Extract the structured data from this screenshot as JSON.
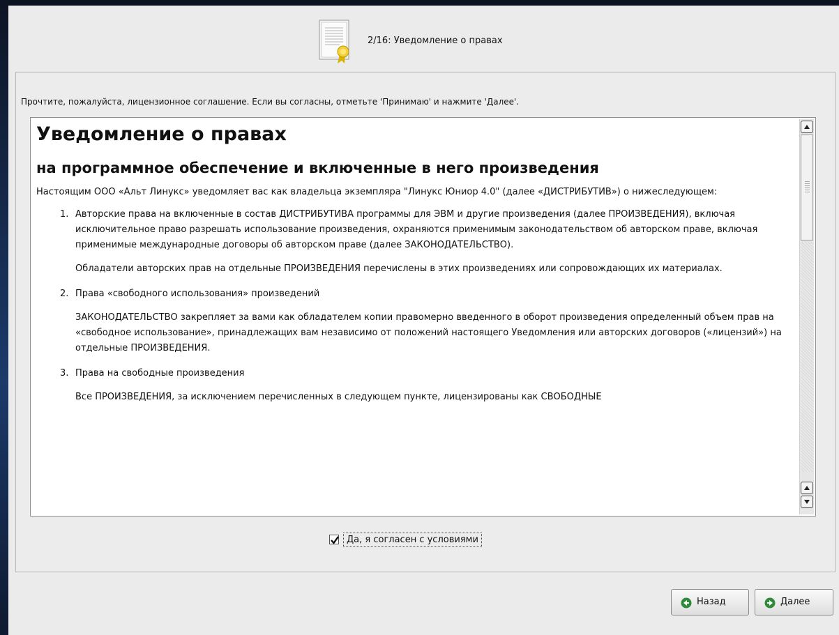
{
  "header": {
    "step_title": "2/16: Уведомление о правах",
    "icon": "certificate-document-icon"
  },
  "instruction": "Прочтите, пожалуйста, лицензионное соглашение. Если вы согласны, отметьте 'Принимаю' и нажмите 'Далее'.",
  "license": {
    "title": "Уведомление о правах",
    "subtitle": "на программное обеспечение и включенные в него произведения",
    "intro": "Настоящим ООО «Альт Линукс» уведомляет вас как владельца экземпляра \"Линукс Юниор 4.0\" (далее «ДИСТРИБУТИВ») о нижеследующем:",
    "items": [
      {
        "num": "1.",
        "text": "Авторские права на включенные в состав ДИСТРИБУТИВА программы для ЭВМ и другие произведения (далее ПРОИЗВЕДЕНИЯ), включая исключительное право разрешать использование произведения, охраняются применимым законодательством об авторском праве, включая применимые международные договоры об авторском праве (далее ЗАКОНОДАТЕЛЬСТВО).",
        "sub": "Обладатели авторских прав на отдельные ПРОИЗВЕДЕНИЯ перечислены в этих произведениях или сопровождающих их материалах."
      },
      {
        "num": "2.",
        "text": "Права «свободного использования» произведений",
        "sub": "ЗАКОНОДАТЕЛЬСТВО закрепляет за вами как обладателем копии правомерно введенного в оборот произведения определенный объем прав на «свободное использование», принадлежащих вам независимо от положений настоящего Уведомления или авторских договоров («лицензий») на отдельные ПРОИЗВЕДЕНИЯ."
      },
      {
        "num": "3.",
        "text": "Права на свободные произведения",
        "sub": "Все ПРОИЗВЕДЕНИЯ, за исключением перечисленных в следующем пункте, лицензированы как СВОБОДНЫЕ"
      }
    ]
  },
  "agree": {
    "checked": true,
    "label": "Да, я согласен с условиями"
  },
  "nav": {
    "back_label": "Назад",
    "next_label": "Далее"
  },
  "colors": {
    "window_bg": "#ebebeb",
    "desktop_bg": "#0b1220",
    "nav_icon_green": "#2f8a3a"
  }
}
